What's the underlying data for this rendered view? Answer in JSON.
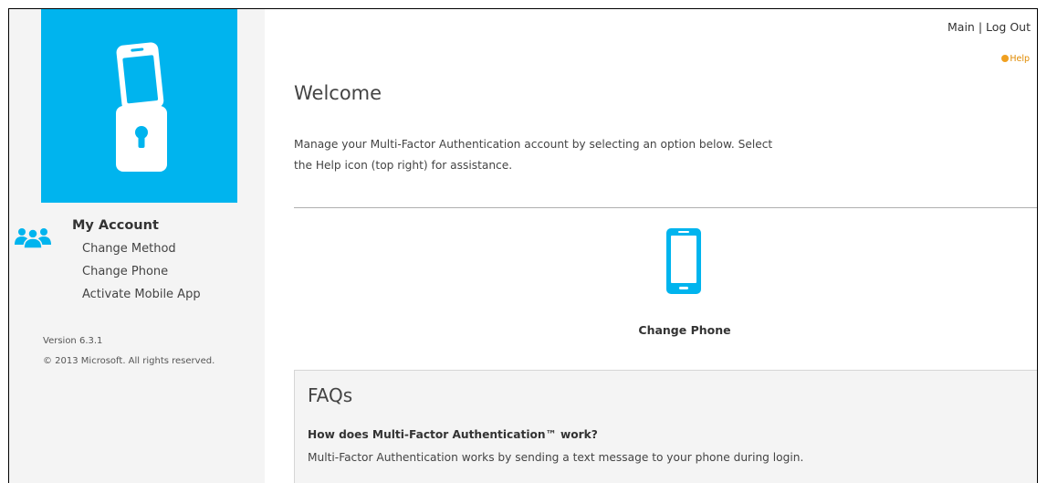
{
  "header": {
    "main_link": "Main",
    "separator": "|",
    "logout_link": "Log Out",
    "help_link": "Help"
  },
  "sidebar": {
    "account_title": "My Account",
    "items": [
      {
        "label": "Change Method"
      },
      {
        "label": "Change Phone"
      },
      {
        "label": "Activate Mobile App"
      }
    ],
    "version": "Version 6.3.1",
    "copyright": "© 2013 Microsoft. All rights reserved."
  },
  "main": {
    "title": "Welcome",
    "intro": "Manage your Multi-Factor Authentication account by selecting an option below. Select the Help icon (top right) for assistance.",
    "tiles": [
      {
        "label": "Change Phone",
        "icon": "phone-icon"
      }
    ]
  },
  "faq": {
    "title": "FAQs",
    "items": [
      {
        "question": "How does Multi-Factor Authentication™ work?",
        "answer": "Multi-Factor Authentication works by sending a text message to your phone during login."
      }
    ]
  },
  "colors": {
    "brand_blue": "#00b4ee",
    "help_orange": "#f0a020",
    "sidebar_bg": "#f4f4f4"
  }
}
